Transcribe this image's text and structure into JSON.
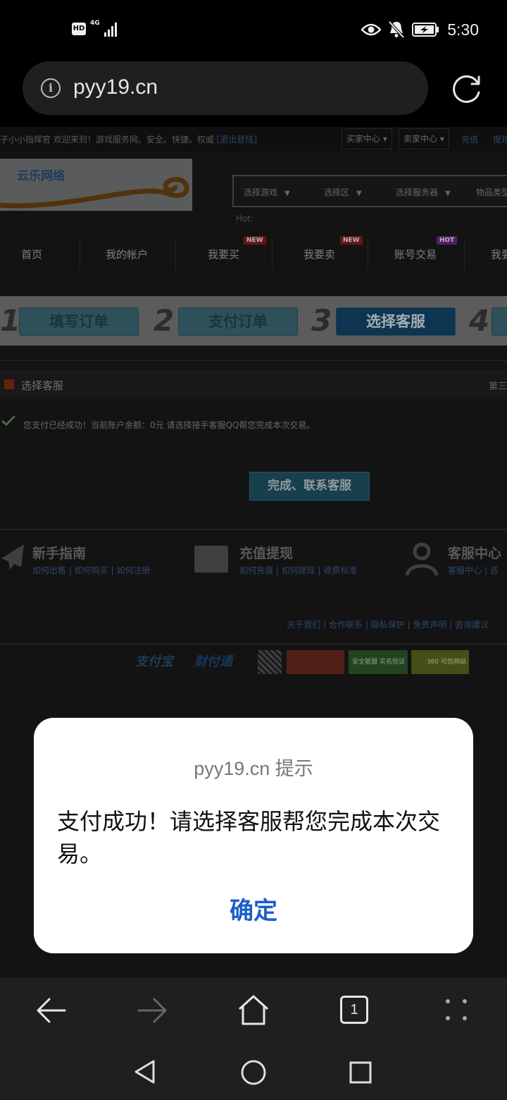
{
  "status_bar": {
    "hd": "HD",
    "network": "4G",
    "time": "5:30",
    "icons": [
      "eye-icon",
      "bell-mute-icon",
      "battery-charging-icon"
    ]
  },
  "browser": {
    "url": "pyy19.cn"
  },
  "site": {
    "welcome": "子小小指挥官 欢迎来到！游戏服务网。安全。快捷。权威",
    "logout": "[退出登陆]",
    "buyer_center": "买家中心",
    "seller_center": "卖家中心",
    "recharge": "充值",
    "withdraw": "提现",
    "logo_text": "云乐网络",
    "selects": [
      "选择游戏",
      "选择区",
      "选择服务器",
      "物品类型"
    ],
    "hot_label": "Hot:",
    "nav": [
      "首页",
      "我的帐户",
      "我要买",
      "我要卖",
      "账号交易",
      "我要"
    ],
    "badges": [
      "NEW",
      "NEW",
      "HOT"
    ],
    "steps": [
      {
        "num": "1",
        "label": "填写订单"
      },
      {
        "num": "2",
        "label": "支付订单"
      },
      {
        "num": "3",
        "label": "选择客服"
      },
      {
        "num": "4",
        "label": ""
      }
    ],
    "section_title": "选择客服",
    "section_right": "第三",
    "message": "您支付已经成功！当前账户余额：0元    请选择接手客服QQ帮您完成本次交易。",
    "done_button": "完成、联系客服",
    "help": [
      {
        "title": "新手指南",
        "links": "如何出售 | 如何购买 | 如何注册"
      },
      {
        "title": "充值提现",
        "links": "如何充值 | 如何提现 | 收费标准"
      },
      {
        "title": "客服中心",
        "links": "客服中心 | 咨"
      }
    ],
    "footer_links": "关于我们 | 合作联系 | 隐私保护 | 免责声明 | 咨询建议",
    "certs": [
      "支付宝",
      "财付通",
      "",
      "",
      "安全联盟 实名验证",
      "360 可信网站"
    ]
  },
  "dialog": {
    "title": "pyy19.cn 提示",
    "message": "支付成功！请选择客服帮您完成本次交易。",
    "ok": "确定"
  },
  "toolbar": {
    "tab_count": "1"
  }
}
